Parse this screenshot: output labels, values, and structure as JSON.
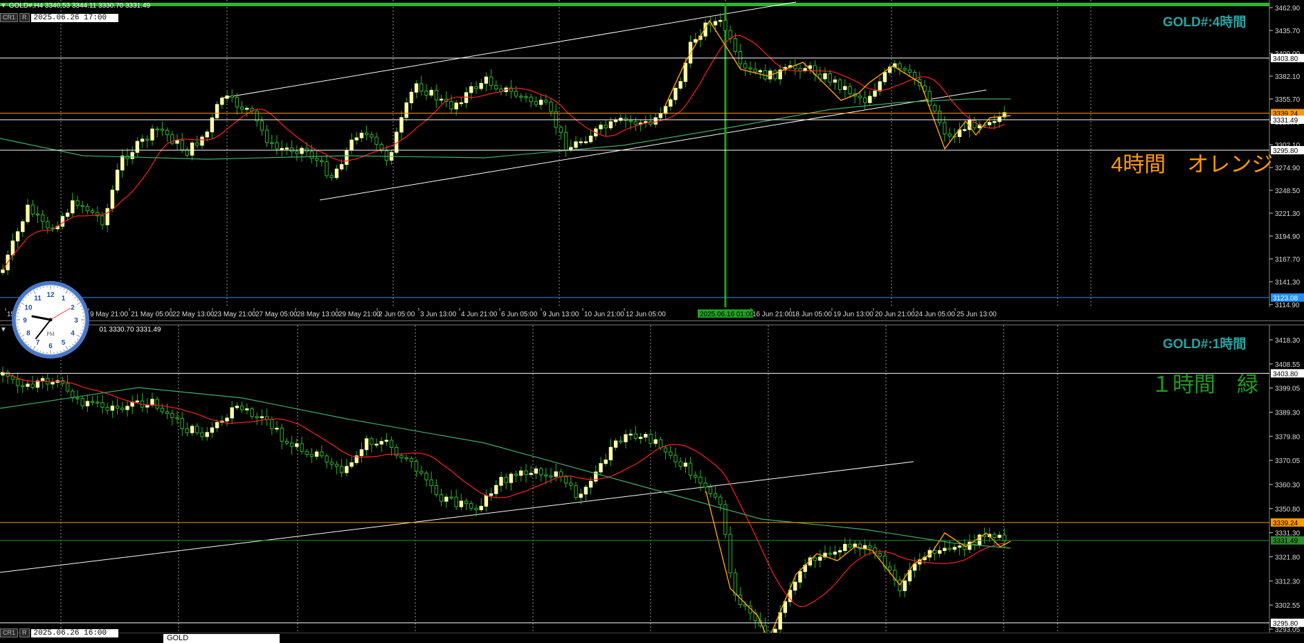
{
  "top": {
    "info": "GOLD#,H4  3340.53 3344.11 3330.70 3331.49",
    "title": "GOLD#:4時間",
    "annotation": "4時間　オレンジ",
    "annotation_color": "#ff9900",
    "price_labels": [
      "3462.90",
      "3435.70",
      "3409.00",
      "3382.10",
      "3355.70",
      "3328.70",
      "3302.10",
      "3274.90",
      "3248.50",
      "3221.30",
      "3194.90",
      "3167.70",
      "3141.30",
      "3114.90"
    ],
    "tagged_levels": [
      {
        "value": "3403.80",
        "color": "#ffffff",
        "text": "#000000"
      },
      {
        "value": "3339.24",
        "color": "#ff9900",
        "text": "#000000"
      },
      {
        "value": "3331.49",
        "color": "#ffffff",
        "text": "#000000"
      },
      {
        "value": "3295.80",
        "color": "#ffffff",
        "text": "#000000"
      },
      {
        "value": "3123.08",
        "color": "#1e90ff",
        "text": "#ffffff"
      }
    ],
    "time_labels": [
      "15",
      "9 May 21:00",
      "21 May 05:00",
      "22 May 13:00",
      "23 May 21:00",
      "27 May 05:00",
      "28 May 13:00",
      "29 May 21:00",
      "2 Jun 05:00",
      "3 Jun 13:00",
      "4 Jun 21:00",
      "6 Jun 05:00",
      "9 Jun 13:00",
      "10 Jun 21:00",
      "12 Jun 05:00",
      "16 Jun 21:00",
      "18 Jun 05:00",
      "19 Jun 13:00",
      "20 Jun 21:00",
      "24 Jun 05:00",
      "25 Jun 13:00"
    ],
    "cursor_time": "2025.06.16 01:00"
  },
  "bottom": {
    "info": "01 3330.70 3331.49",
    "title": "GOLD#:1時間",
    "annotation": "１時間　緑",
    "annotation_color": "#1f9a1f",
    "price_labels": [
      "3418.30",
      "3408.55",
      "3399.05",
      "3389.30",
      "3379.80",
      "3370.05",
      "3360.30",
      "3350.80",
      "3331.30",
      "3321.80",
      "3312.30",
      "3302.55",
      "3293.05"
    ],
    "tagged_levels": [
      {
        "value": "3403.80",
        "color": "#ffffff",
        "text": "#000000"
      },
      {
        "value": "3339.24",
        "color": "#ff9900",
        "text": "#000000"
      },
      {
        "value": "3331.49",
        "color": "#2e8b2e",
        "text": "#000000"
      },
      {
        "value": "3295.80",
        "color": "#ffffff",
        "text": "#000000"
      }
    ]
  },
  "toolbar": {
    "mode_cr": "CR1",
    "mode_r": "R",
    "top_cursor_date": "2025.06.26 17:00",
    "bottom_cursor_date": "2025.06.26 16:00"
  },
  "bottom_tab": {
    "label": "GOLD"
  },
  "clock": {
    "numerals": [
      "12",
      "1",
      "2",
      "3",
      "4",
      "5",
      "6",
      "7",
      "8",
      "9",
      "10",
      "11"
    ],
    "period": "PM"
  },
  "colors": {
    "ma_red": "#ff2020",
    "ma_green": "#3fae6a",
    "zigzag": "#ffa500",
    "candle": "#ffffa8",
    "channel": "#ffffff",
    "vline": "#1fa31f"
  }
}
